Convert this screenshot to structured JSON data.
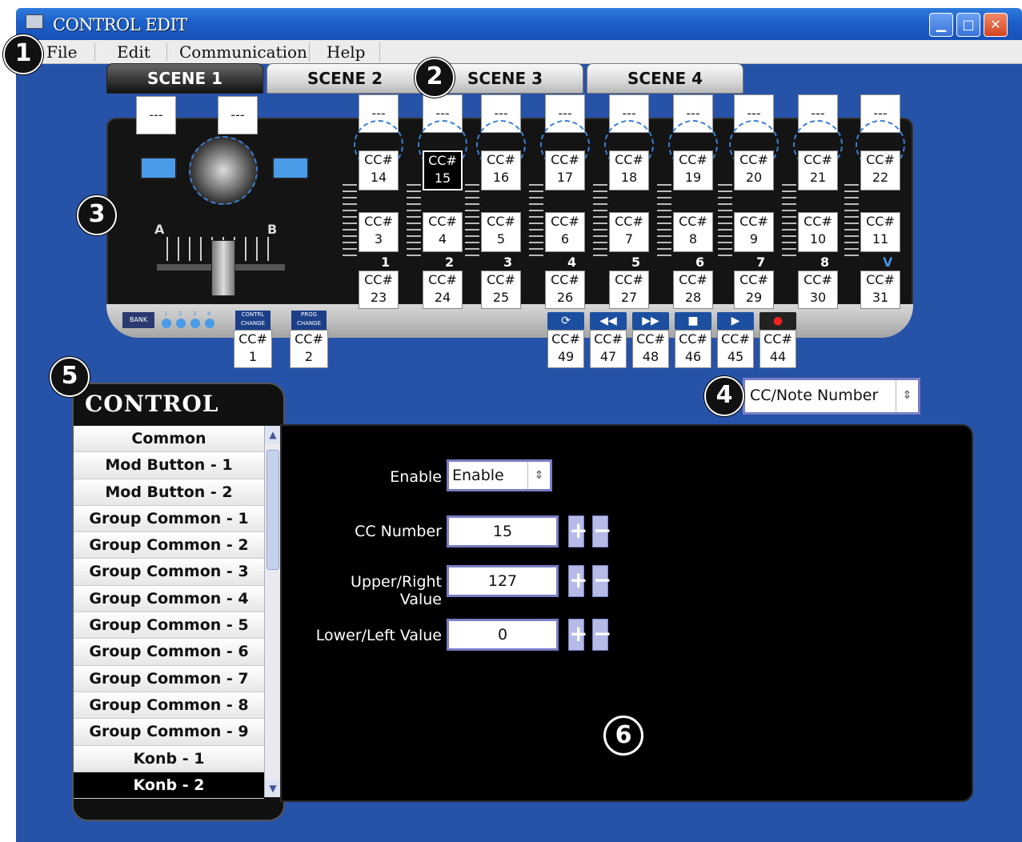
{
  "window": {
    "title": "CONTROL EDIT"
  },
  "menu": {
    "items": [
      {
        "label": "File"
      },
      {
        "label": "Edit"
      },
      {
        "label": "Communication"
      },
      {
        "label": "Help"
      }
    ]
  },
  "scenes": [
    {
      "label": "SCENE 1"
    },
    {
      "label": "SCENE 2"
    },
    {
      "label": "SCENE 3"
    },
    {
      "label": "SCENE 4"
    }
  ],
  "markers": [
    "1",
    "2",
    "3",
    "4",
    "5",
    "6"
  ],
  "controller": {
    "dash": "---",
    "cc_prefix": "CC#",
    "knobs": [
      "14",
      "15",
      "16",
      "17",
      "18",
      "19",
      "20",
      "21",
      "22"
    ],
    "sliders": [
      "3",
      "4",
      "5",
      "6",
      "7",
      "8",
      "9",
      "10",
      "11"
    ],
    "buttons": [
      "23",
      "24",
      "25",
      "26",
      "27",
      "28",
      "29",
      "30",
      "31"
    ],
    "group_numbers": [
      "1",
      "2",
      "3",
      "4",
      "5",
      "6",
      "7",
      "8",
      "V"
    ],
    "crossfader": {
      "left": "A",
      "right": "B"
    },
    "bottom": [
      {
        "cc": "1",
        "label": "CONTRL CHANGE"
      },
      {
        "cc": "2",
        "label": "PROG CHANGE"
      }
    ],
    "bank_label": "BANK",
    "bank_numbers": [
      "1",
      "2",
      "3",
      "4"
    ],
    "transport": [
      {
        "icon": "cycle-icon",
        "glyph": "⟳",
        "cc": "49"
      },
      {
        "icon": "rewind-icon",
        "glyph": "◀◀",
        "cc": "47"
      },
      {
        "icon": "fast-forward-icon",
        "glyph": "▶▶",
        "cc": "48"
      },
      {
        "icon": "stop-icon",
        "glyph": "■",
        "cc": "46"
      },
      {
        "icon": "play-icon",
        "glyph": "▶",
        "cc": "45"
      },
      {
        "icon": "record-icon",
        "glyph": "●",
        "cc": "44"
      }
    ]
  },
  "display_mode": {
    "value": "CC/Note Number"
  },
  "control_panel": {
    "header": "CONTROL",
    "items": [
      "Common",
      "Mod Button - 1",
      "Mod Button - 2",
      "Group Common - 1",
      "Group Common - 2",
      "Group Common - 3",
      "Group Common - 4",
      "Group Common - 5",
      "Group Common - 6",
      "Group Common - 7",
      "Group Common - 8",
      "Group Common - 9",
      "Konb - 1",
      "Konb - 2"
    ],
    "selected_index": 13
  },
  "form": {
    "enable": {
      "label": "Enable",
      "value": "Enable"
    },
    "cc_number": {
      "label": "CC Number",
      "value": "15"
    },
    "upper_value": {
      "label": "Upper/Right Value",
      "value": "127"
    },
    "lower_value": {
      "label": "Lower/Left Value",
      "value": "0"
    },
    "plus": "+",
    "minus": "−"
  }
}
